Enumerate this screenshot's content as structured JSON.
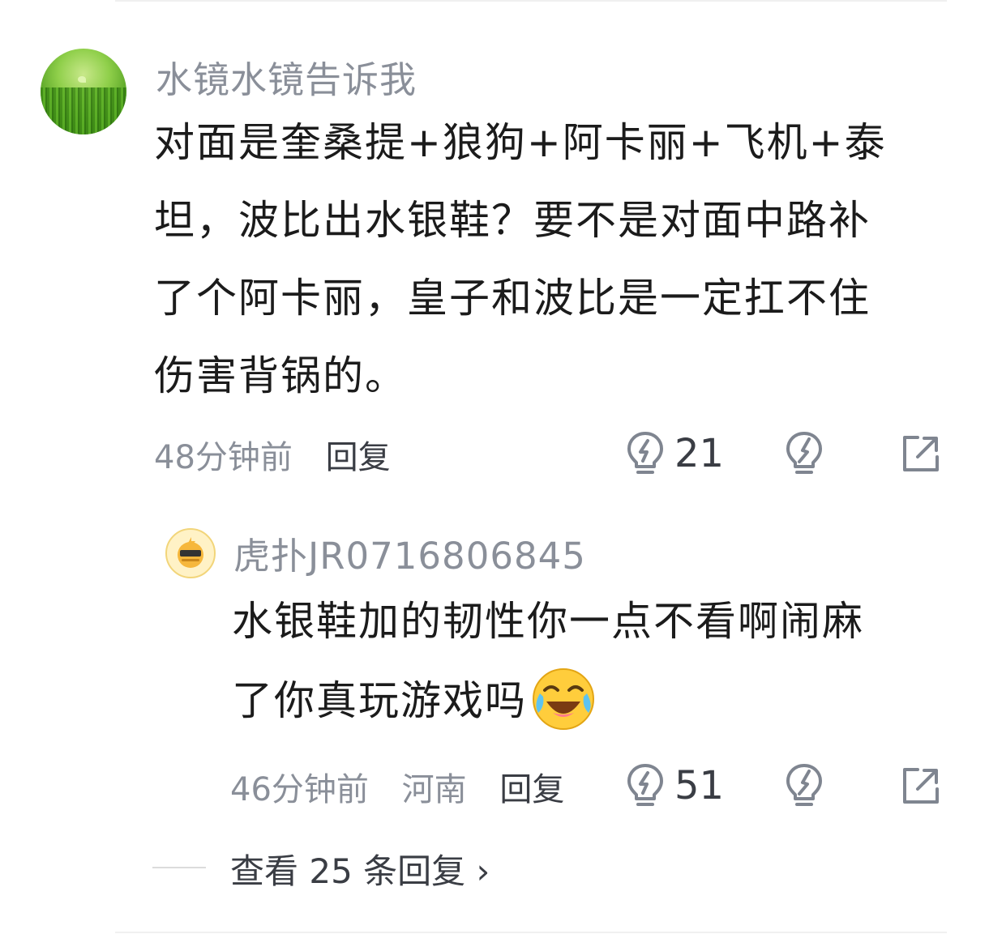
{
  "comment": {
    "username": "水镜水镜告诉我",
    "content_lines": [
      "对面是奎桑提+狼狗+阿卡丽+飞机+泰",
      "坦，波比出水银鞋？要不是对面中路补",
      "了个阿卡丽，皇子和波比是一定扛不住",
      "伤害背锅的。"
    ],
    "time": "48分钟前",
    "reply_label": "回复",
    "like_count": "21"
  },
  "reply": {
    "username": "虎扑JR0716806845",
    "content_lines": [
      "水银鞋加的韧性你一点不看啊闹麻",
      "了你真玩游戏吗"
    ],
    "emoji": "laughing-crying-emoji",
    "time": "46分钟前",
    "location": "河南",
    "reply_label": "回复",
    "like_count": "51"
  },
  "view_more": {
    "label": "查看 25 条回复 ›"
  },
  "icons": {
    "like": "lightbulb-like-icon",
    "dislike": "lightbulb-dislike-icon",
    "share": "share-icon"
  },
  "colors": {
    "text": "#1b1b1b",
    "meta": "#8a8f99",
    "icon": "#7f8590"
  }
}
